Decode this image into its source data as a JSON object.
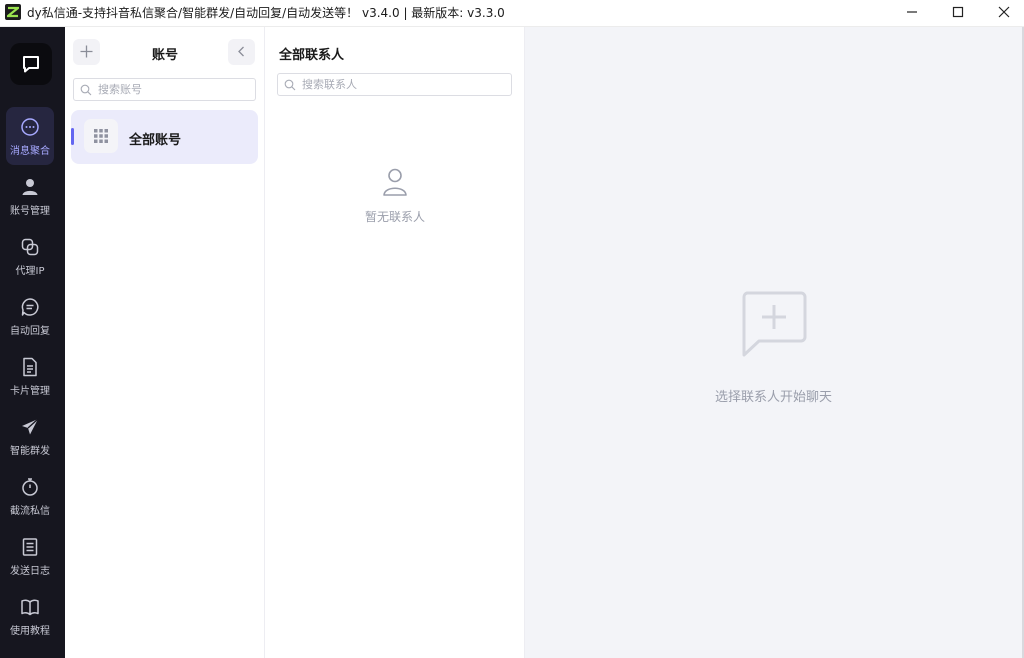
{
  "window": {
    "title": "dy私信通-支持抖音私信聚合/智能群发/自动回复/自动发送等！  v3.4.0 | 最新版本: v3.3.0",
    "controls": [
      "minimize-icon",
      "maximize-icon",
      "close-icon"
    ]
  },
  "rail": {
    "logo_icon": "chat-bubble-icon",
    "items": [
      {
        "label": "消息聚合",
        "icon": "message-dots-icon",
        "active": true
      },
      {
        "label": "账号管理",
        "icon": "user-icon",
        "active": false
      },
      {
        "label": "代理IP",
        "icon": "link-icon",
        "active": false
      },
      {
        "label": "自动回复",
        "icon": "chat-reply-icon",
        "active": false
      },
      {
        "label": "卡片管理",
        "icon": "document-icon",
        "active": false
      },
      {
        "label": "智能群发",
        "icon": "send-icon",
        "active": false
      },
      {
        "label": "截流私信",
        "icon": "stopwatch-icon",
        "active": false
      },
      {
        "label": "发送日志",
        "icon": "log-icon",
        "active": false
      },
      {
        "label": "使用教程",
        "icon": "book-icon",
        "active": false
      }
    ],
    "active_color": "#a7a9ff"
  },
  "accounts": {
    "title": "账号",
    "search_placeholder": "搜索账号",
    "items": [
      {
        "name": "全部账号",
        "icon": "grid-icon",
        "selected": true
      }
    ],
    "accent": "#6366f1"
  },
  "contacts": {
    "title": "全部联系人",
    "search_placeholder": "搜索联系人",
    "empty_text": "暂无联系人",
    "empty_icon": "user-outline-icon"
  },
  "chat": {
    "empty_text": "选择联系人开始聊天",
    "empty_icon": "chat-plus-icon"
  }
}
